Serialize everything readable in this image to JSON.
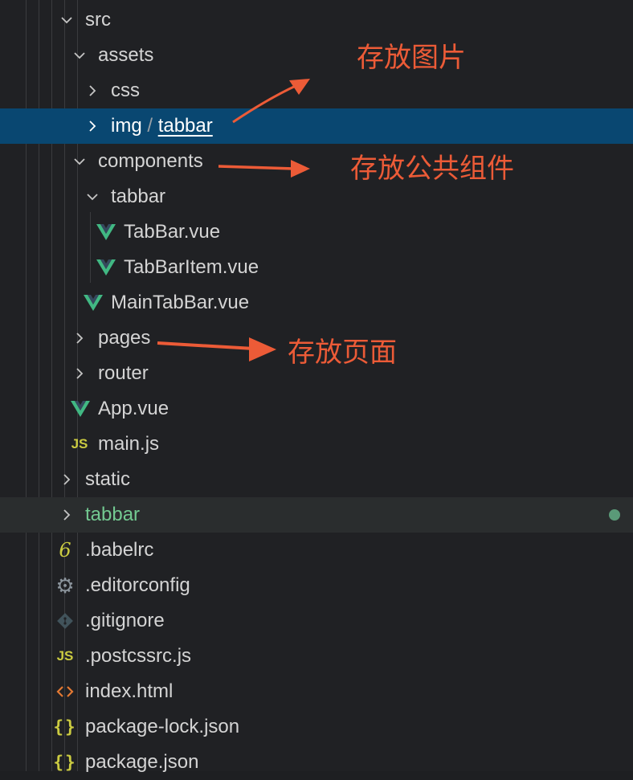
{
  "tree": {
    "rows": [
      {
        "label": "src",
        "kind": "folder",
        "open": true
      },
      {
        "label": "assets",
        "kind": "folder",
        "open": true
      },
      {
        "label": "css",
        "kind": "folder",
        "open": false
      },
      {
        "label_a": "img",
        "label_sep": " / ",
        "label_b": "tabbar",
        "kind": "folder",
        "open": false,
        "selected": true
      },
      {
        "label": "components",
        "kind": "folder",
        "open": true
      },
      {
        "label": "tabbar",
        "kind": "folder",
        "open": true
      },
      {
        "label": "TabBar.vue",
        "kind": "vue"
      },
      {
        "label": "TabBarItem.vue",
        "kind": "vue"
      },
      {
        "label": "MainTabBar.vue",
        "kind": "vue"
      },
      {
        "label": "pages",
        "kind": "folder",
        "open": false
      },
      {
        "label": "router",
        "kind": "folder",
        "open": false
      },
      {
        "label": "App.vue",
        "kind": "vue"
      },
      {
        "label": "main.js",
        "kind": "js",
        "icon_text": "JS"
      },
      {
        "label": "static",
        "kind": "folder",
        "open": false
      },
      {
        "label": "tabbar",
        "kind": "folder",
        "open": false,
        "modified": true
      },
      {
        "label": ".babelrc",
        "kind": "babel",
        "icon_text": "6"
      },
      {
        "label": ".editorconfig",
        "kind": "config",
        "icon_text": "⚙"
      },
      {
        "label": ".gitignore",
        "kind": "git"
      },
      {
        "label": ".postcssrc.js",
        "kind": "js",
        "icon_text": "JS"
      },
      {
        "label": "index.html",
        "kind": "html"
      },
      {
        "label": "package-lock.json",
        "kind": "json",
        "icon_text": "{}"
      },
      {
        "label": "package.json",
        "kind": "json",
        "icon_text": "{}"
      }
    ]
  },
  "annotations": {
    "images": "存放图片",
    "components": "存放公共组件",
    "pages": "存放页面"
  },
  "colors": {
    "background": "#202124",
    "selected": "#094771",
    "modified_text": "#73c991",
    "vue_icon": "#41b883",
    "annotation": "#ec5b37"
  }
}
